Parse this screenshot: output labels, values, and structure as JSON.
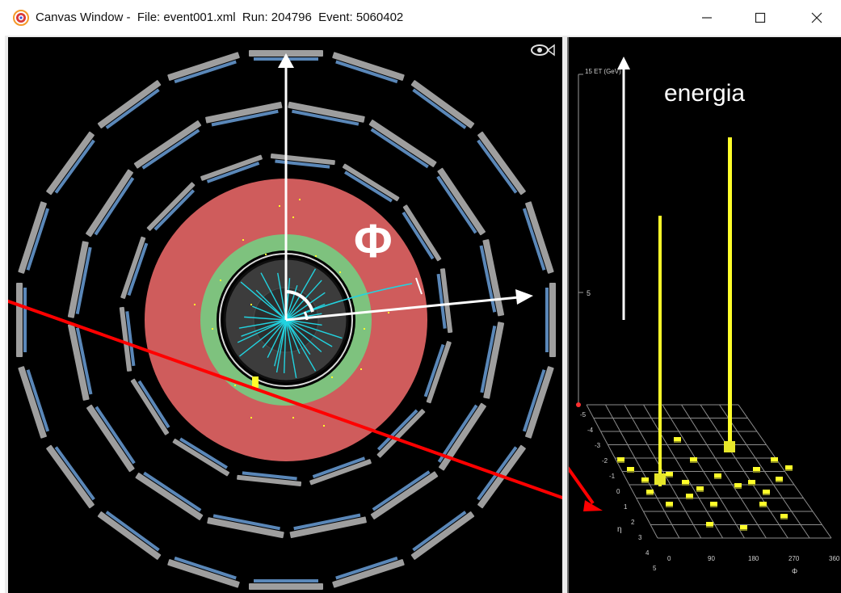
{
  "window": {
    "title": "Canvas Window -  File: event001.xml  Run: 204796  Event: 5060402",
    "app_icon": "atlantis-target-icon",
    "controls": [
      "minimize-icon",
      "maximize-icon",
      "close-icon"
    ]
  },
  "main_view": {
    "phi_label": "Φ",
    "eye_icon": "fish-eye-icon"
  },
  "lego_plot": {
    "energy_label": "energia",
    "z_axis_label": "15 ET (GeV)",
    "z_tick_label": "5",
    "eta_axis_label": "η",
    "phi_axis_label": "Φ",
    "eta_ticks": [
      "-5",
      "-4",
      "-3",
      "-2",
      "-1",
      "0",
      "1",
      "2",
      "3",
      "4",
      "5"
    ],
    "phi_ticks": [
      "0",
      "90",
      "180",
      "270",
      "360"
    ]
  },
  "colors": {
    "calorimeter_outer": "#cf5c5c",
    "calorimeter_inner": "#7ec27e",
    "tracks": "#22d3e0",
    "muon_chambers": "#9e9e9e",
    "muon_blue": "#5a87b8",
    "towers": "#ffff2a",
    "annotation_arrow": "#ff0000"
  }
}
